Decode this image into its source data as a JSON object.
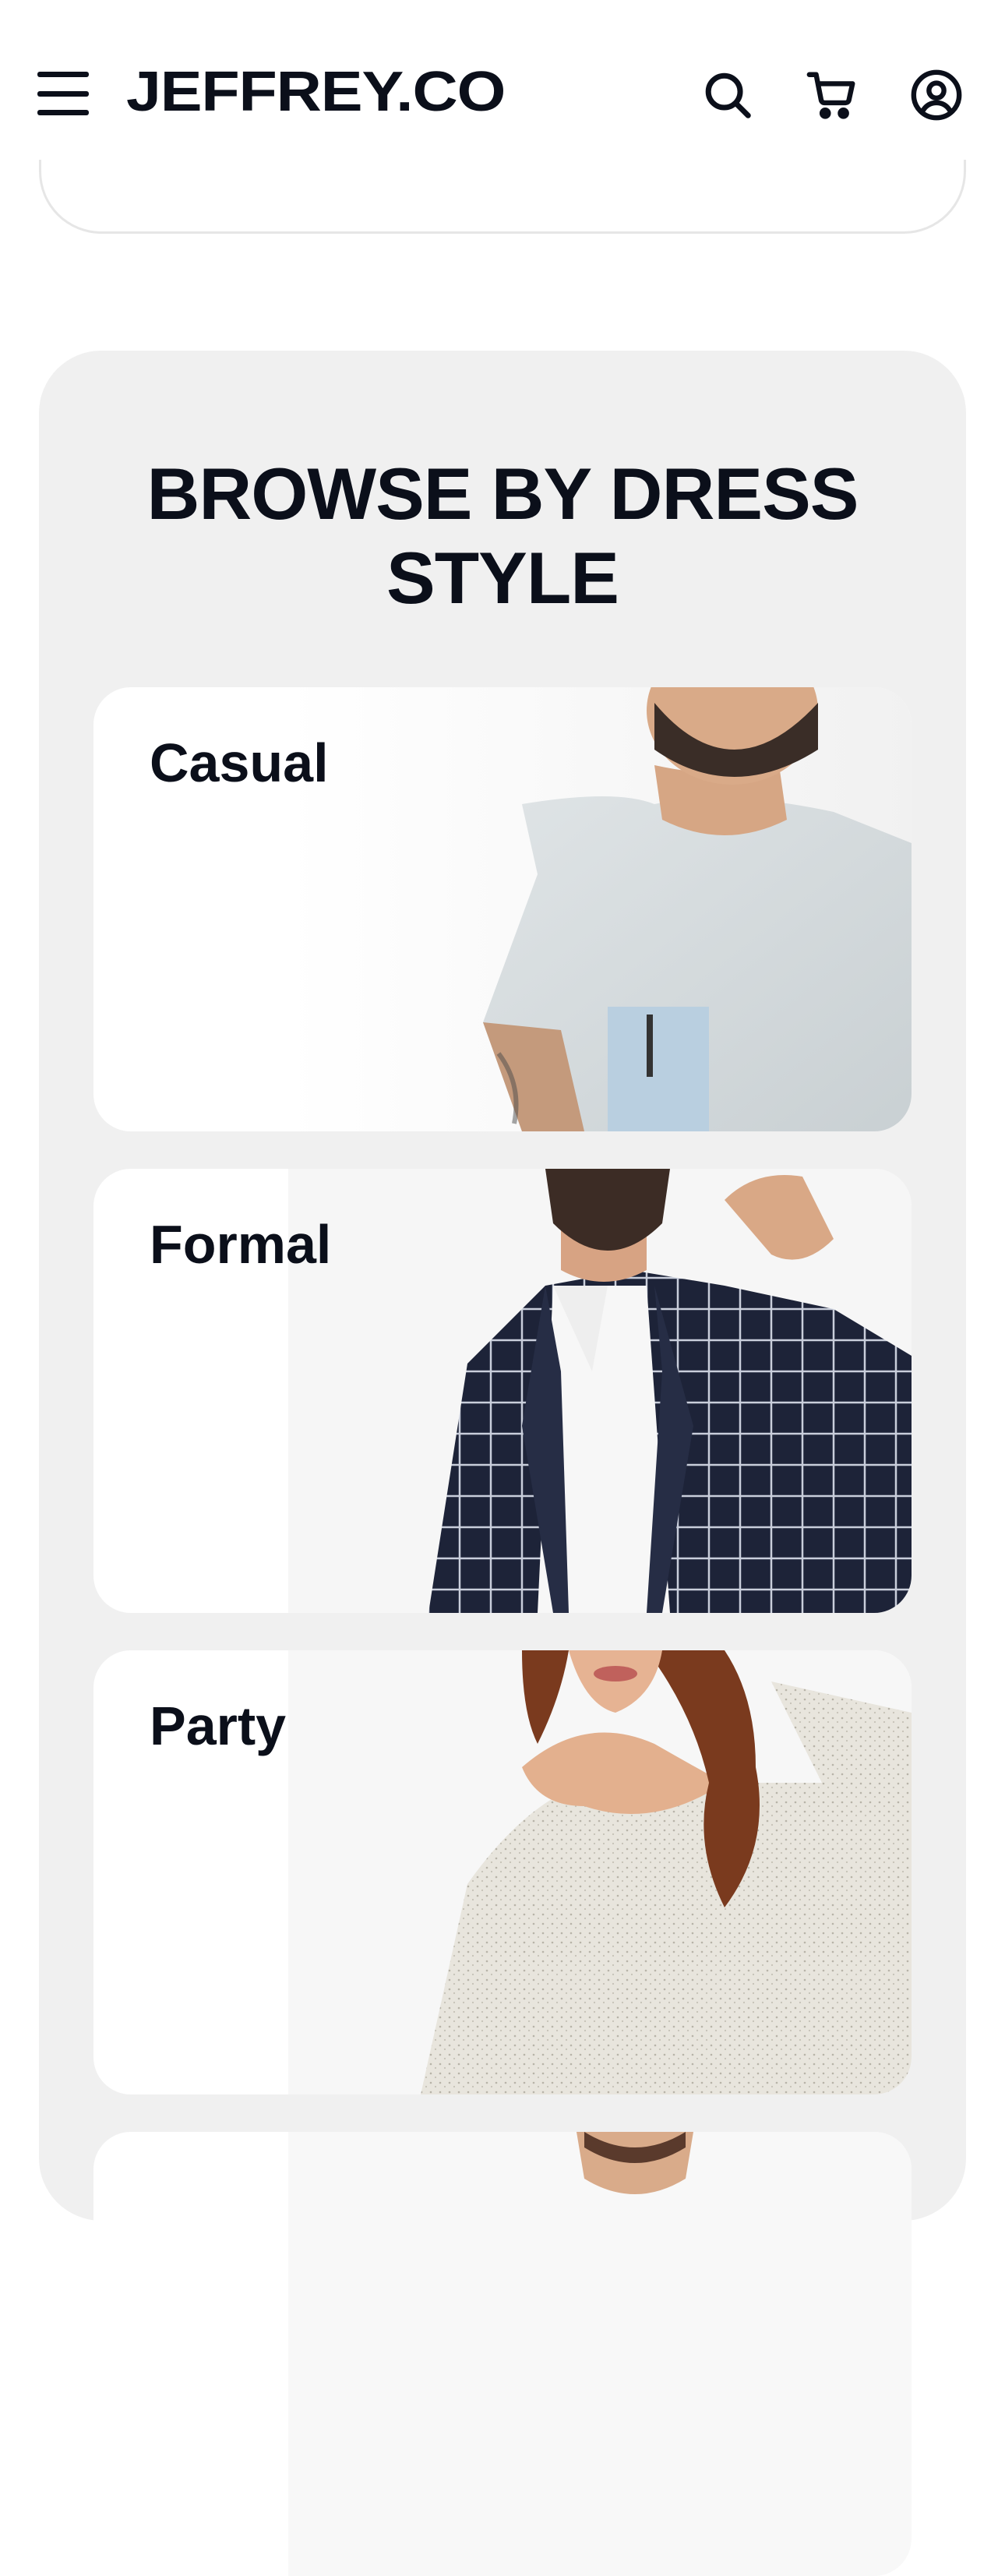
{
  "header": {
    "logo": "JEFFREY.CO",
    "menu_icon": "hamburger-menu-icon",
    "search_icon": "search-icon",
    "cart_icon": "cart-icon",
    "account_icon": "user-account-icon"
  },
  "browse": {
    "title_line1": "BROWSE BY DRESS",
    "title_line2": "STYLE",
    "styles": [
      {
        "label": "Casual"
      },
      {
        "label": "Formal"
      },
      {
        "label": "Party"
      },
      {
        "label": ""
      }
    ]
  },
  "colors": {
    "text": "#0b0f1a",
    "section_bg": "#f0f0f0",
    "card_bg": "#ffffff"
  }
}
